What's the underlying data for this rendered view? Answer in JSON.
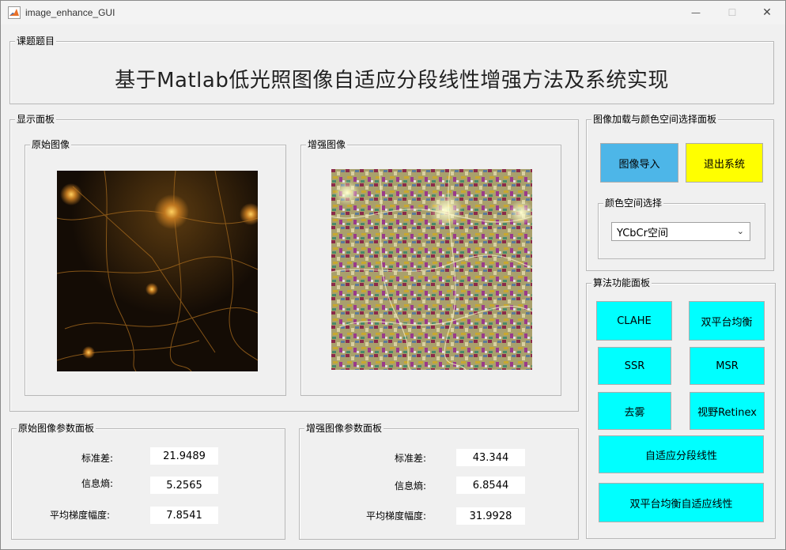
{
  "window": {
    "title": "image_enhance_GUI",
    "controls": {
      "minimize": "—",
      "maximize": "☐",
      "close": "✕"
    }
  },
  "title_panel": {
    "legend": "课题题目",
    "title": "基于Matlab低光照图像自适应分段线性增强方法及系统实现"
  },
  "display_panel": {
    "legend": "显示面板",
    "original_legend": "原始图像",
    "enhanced_legend": "增强图像"
  },
  "load_panel": {
    "legend": "图像加载与颜色空间选择面板",
    "import_button": "图像导入",
    "exit_button": "退出系统",
    "color_space_legend": "颜色空间选择",
    "color_space_value": "YCbCr空间",
    "colors": {
      "import": "#4db6e8",
      "exit": "#ffff00"
    }
  },
  "algo_panel": {
    "legend": "算法功能面板",
    "buttons": [
      "CLAHE",
      "双平台均衡",
      "SSR",
      "MSR",
      "去雾",
      "视野Retinex",
      "自适应分段线性",
      "双平台均衡自适应线性"
    ],
    "color": "#00ffff"
  },
  "orig_params": {
    "legend": "原始图像参数面板",
    "labels": [
      "标准差:",
      "信息熵:",
      "平均梯度幅度:"
    ],
    "values": [
      "21.9489",
      "5.2565",
      "7.8541"
    ]
  },
  "enh_params": {
    "legend": "增强图像参数面板",
    "labels": [
      "标准差:",
      "信息熵:",
      "平均梯度幅度:"
    ],
    "values": [
      "43.344",
      "6.8544",
      "31.9928"
    ]
  }
}
